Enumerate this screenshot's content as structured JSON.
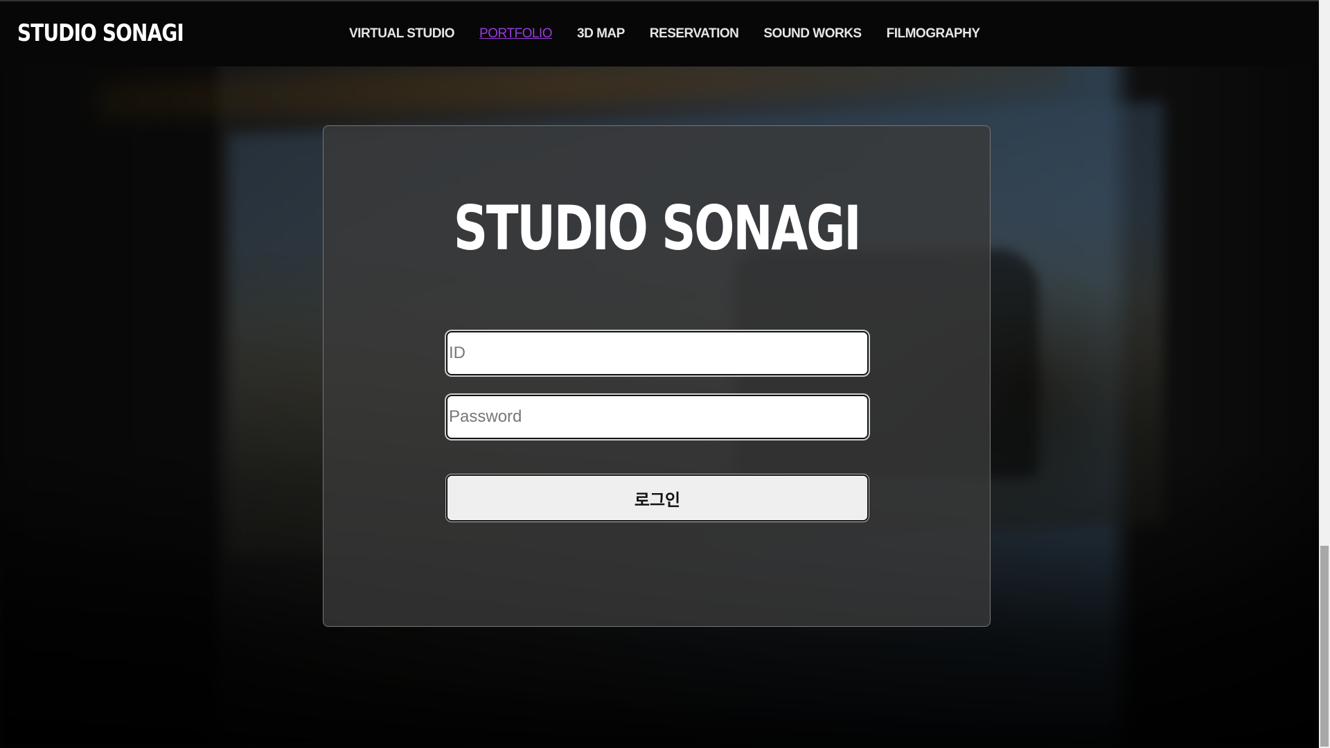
{
  "header": {
    "brand": "STUDIO SONAGI",
    "nav": [
      {
        "label": "VIRTUAL STUDIO",
        "active": false
      },
      {
        "label": "PORTFOLIO",
        "active": true
      },
      {
        "label": "3D MAP",
        "active": false
      },
      {
        "label": "RESERVATION",
        "active": false
      },
      {
        "label": "SOUND WORKS",
        "active": false
      },
      {
        "label": "FILMOGRAPHY",
        "active": false
      }
    ]
  },
  "login": {
    "title": "STUDIO SONAGI",
    "id_field": {
      "value": "",
      "placeholder": "ID"
    },
    "password_field": {
      "value": "",
      "placeholder": "Password"
    },
    "submit_label": "로그인"
  },
  "colors": {
    "nav_active": "#9b3be0",
    "nav_text": "#e6e6e6",
    "navbar_bg": "#070707",
    "card_bg": "#3a3a3a"
  }
}
